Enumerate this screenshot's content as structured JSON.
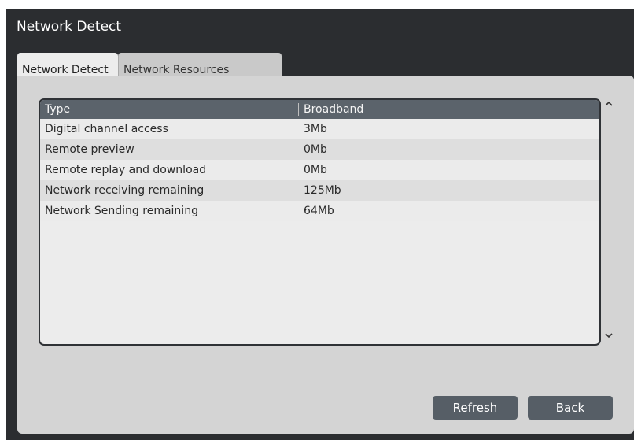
{
  "window": {
    "title": "Network Detect"
  },
  "tabs": [
    {
      "label": "Network Detect",
      "active": true
    },
    {
      "label": "Network Resources Statistics",
      "active": false
    }
  ],
  "table": {
    "columns": [
      "Type",
      "Broadband"
    ],
    "rows": [
      [
        "Digital channel access",
        "3Mb"
      ],
      [
        "Remote preview",
        "0Mb"
      ],
      [
        "Remote replay and download",
        "0Mb"
      ],
      [
        "Network receiving remaining",
        "125Mb"
      ],
      [
        "Network Sending remaining",
        "64Mb"
      ]
    ]
  },
  "scroll": {
    "up_icon": "chevron-up-icon",
    "down_icon": "chevron-down-icon"
  },
  "buttons": {
    "refresh": "Refresh",
    "back": "Back"
  },
  "colors": {
    "window_bg": "#2b2d30",
    "panel_bg": "#d4d4d4",
    "header_bg": "#5b636b",
    "button_bg": "#565e66"
  }
}
